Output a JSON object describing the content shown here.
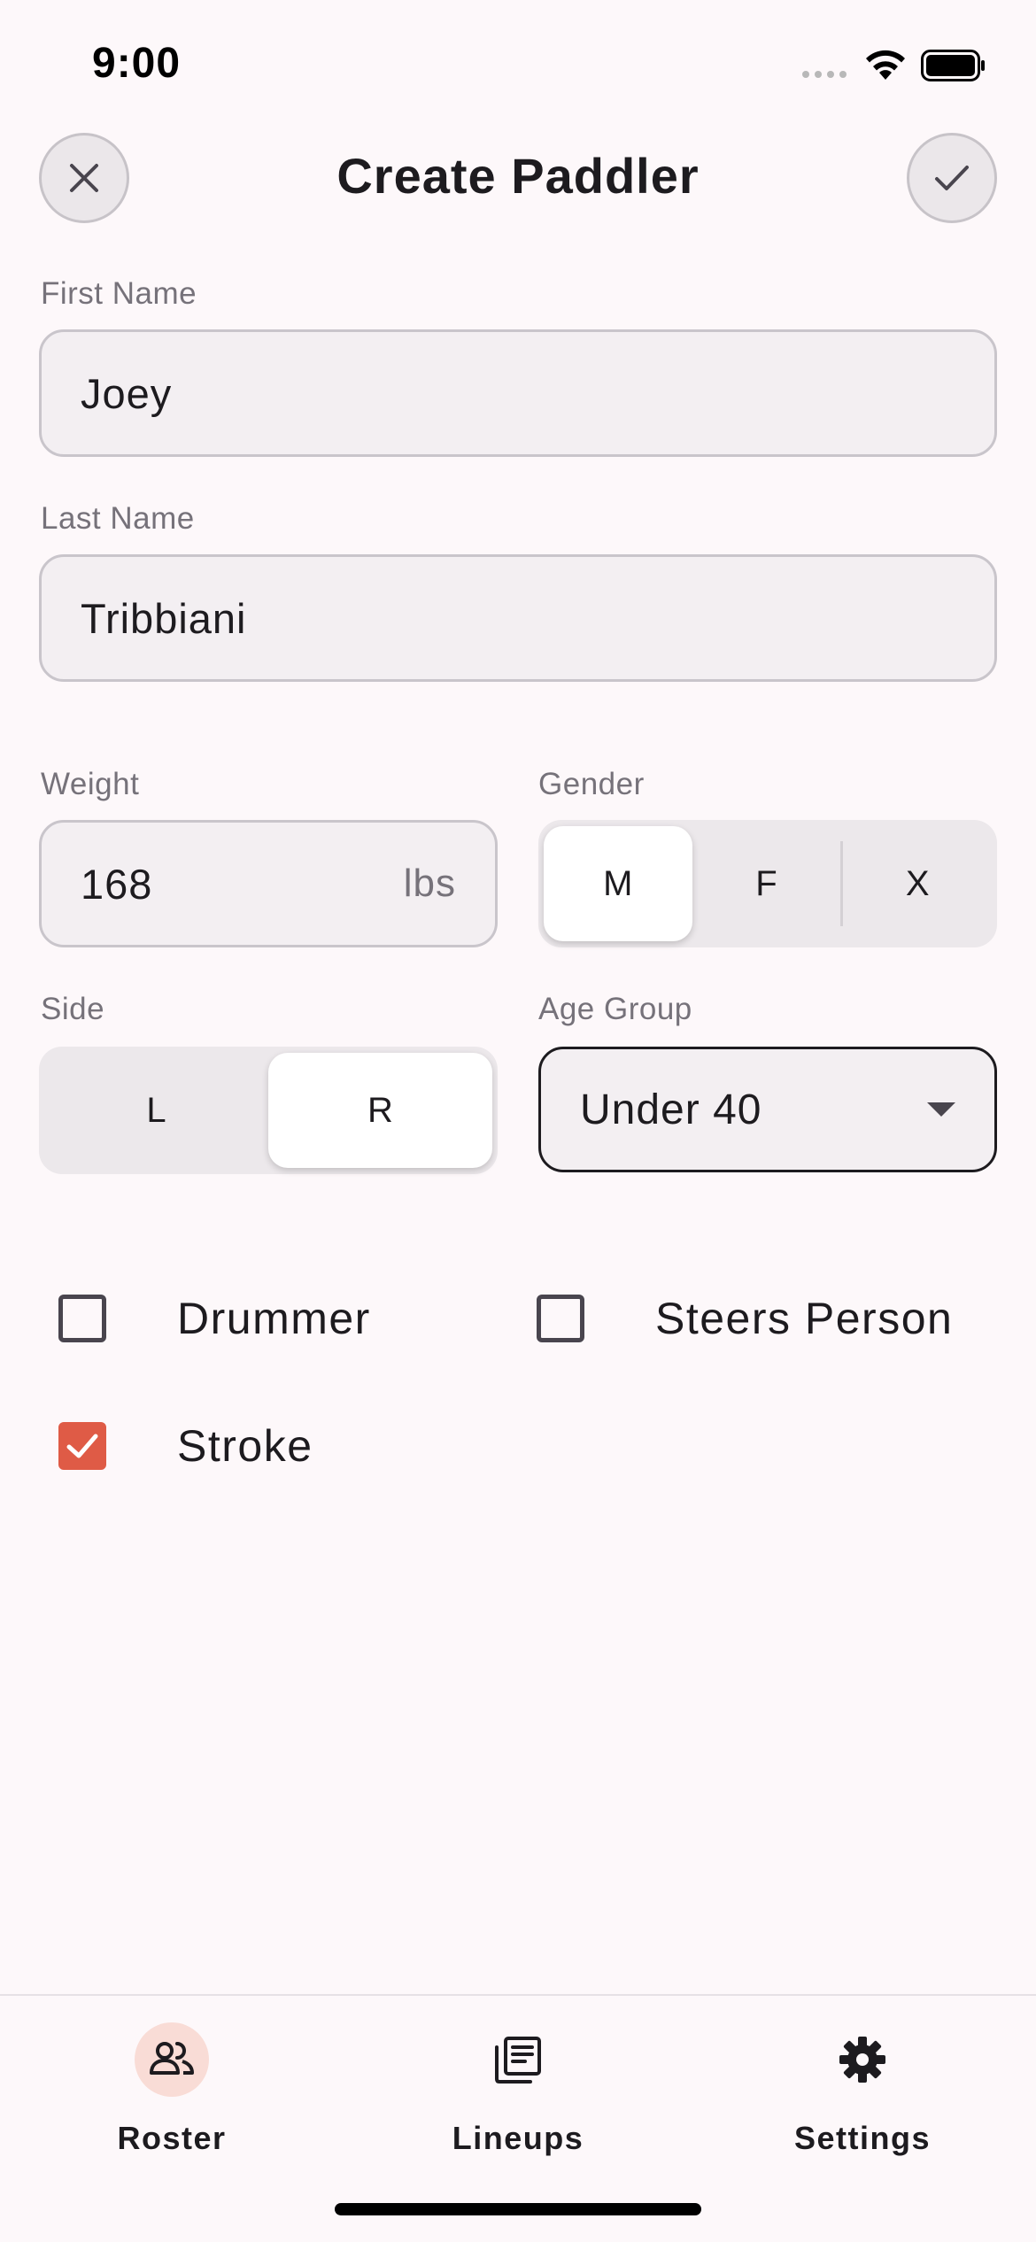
{
  "status_bar": {
    "time": "9:00"
  },
  "header": {
    "title": "Create Paddler"
  },
  "form": {
    "first_name": {
      "label": "First Name",
      "value": "Joey"
    },
    "last_name": {
      "label": "Last Name",
      "value": "Tribbiani"
    },
    "weight": {
      "label": "Weight",
      "value": "168",
      "unit": "lbs"
    },
    "gender": {
      "label": "Gender",
      "options": [
        "M",
        "F",
        "X"
      ],
      "selected": "M"
    },
    "side": {
      "label": "Side",
      "options": [
        "L",
        "R"
      ],
      "selected": "R"
    },
    "age_group": {
      "label": "Age Group",
      "value": "Under 40"
    },
    "checkboxes": [
      {
        "label": "Drummer",
        "checked": false
      },
      {
        "label": "Steers Person",
        "checked": false
      },
      {
        "label": "Stroke",
        "checked": true
      }
    ]
  },
  "nav": {
    "items": [
      {
        "label": "Roster",
        "icon": "people-icon",
        "active": true
      },
      {
        "label": "Lineups",
        "icon": "lineups-icon",
        "active": false
      },
      {
        "label": "Settings",
        "icon": "gear-icon",
        "active": false
      }
    ]
  },
  "colors": {
    "accent": "#df5b46",
    "active_nav_bg": "#f9dcd6",
    "background": "#fdf8fa"
  }
}
